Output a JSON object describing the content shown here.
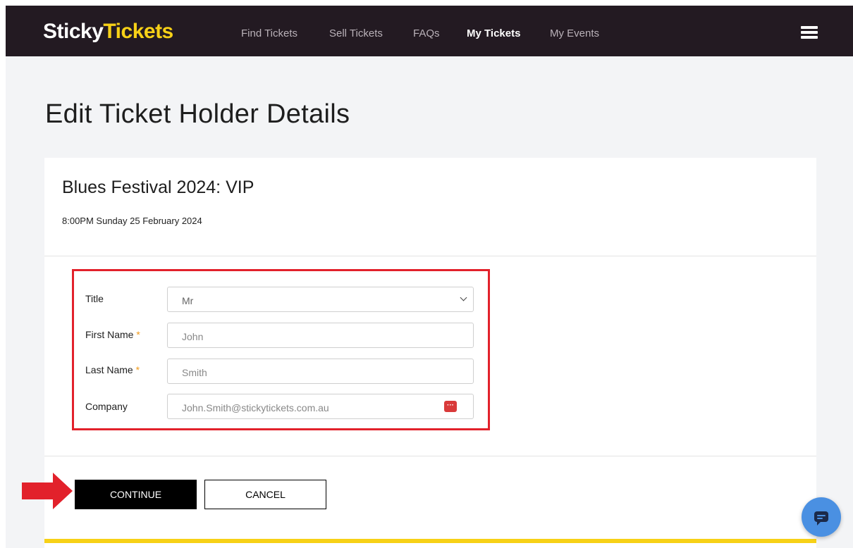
{
  "header": {
    "logo_part1": "Sticky",
    "logo_part2": "Tickets",
    "nav": [
      "Find Tickets",
      "Sell Tickets",
      "FAQs",
      "My Tickets",
      "My Events"
    ],
    "active_nav": "My Tickets"
  },
  "page": {
    "title": "Edit Ticket Holder Details"
  },
  "event": {
    "name": "Blues Festival 2024: VIP",
    "datetime": "8:00PM Sunday 25 February 2024"
  },
  "form": {
    "title_label": "Title",
    "title_value": "Mr",
    "first_name_label": "First Name",
    "first_name_value": "John",
    "last_name_label": "Last Name",
    "last_name_value": "Smith",
    "company_label": "Company",
    "company_value": "John.Smith@stickytickets.com.au",
    "required_marker": "*",
    "password_icon_glyph": "···"
  },
  "actions": {
    "continue_label": "CONTINUE",
    "cancel_label": "CANCEL"
  },
  "colors": {
    "header_bg": "#231a22",
    "brand_yellow": "#f7d117",
    "highlight_red": "#e2212b",
    "chat_blue": "#4a90e2"
  }
}
